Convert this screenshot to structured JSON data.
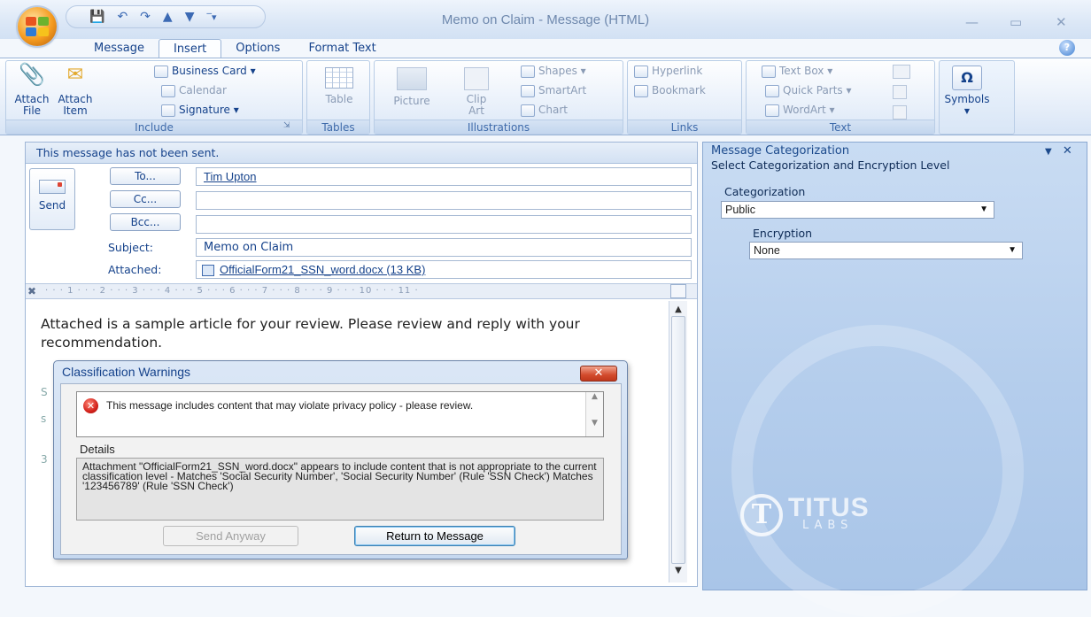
{
  "window": {
    "title": "Memo on Claim  - Message (HTML)"
  },
  "ribbon": {
    "tabs": [
      "Message",
      "Insert",
      "Options",
      "Format Text"
    ],
    "active_tab": "Insert",
    "groups": {
      "include": {
        "label": "Include",
        "attach_file": [
          "Attach",
          "File"
        ],
        "attach_item": [
          "Attach",
          "Item"
        ],
        "business_card": "Business Card ▾",
        "calendar": "Calendar",
        "signature": "Signature ▾"
      },
      "tables": {
        "label": "Tables",
        "table": "Table"
      },
      "illustrations": {
        "label": "Illustrations",
        "picture": "Picture",
        "clip_art": [
          "Clip",
          "Art"
        ],
        "shapes": "Shapes ▾",
        "smartart": "SmartArt",
        "chart": "Chart"
      },
      "links": {
        "label": "Links",
        "hyperlink": "Hyperlink",
        "bookmark": "Bookmark"
      },
      "text": {
        "label": "Text",
        "text_box": "Text Box ▾",
        "quick_parts": "Quick Parts ▾",
        "wordart": "WordArt ▾"
      },
      "symbols": {
        "label": "Symbols"
      }
    }
  },
  "message": {
    "info_bar": "This message has not been sent.",
    "send_label": "Send",
    "to_button": "To...",
    "cc_button": "Cc...",
    "bcc_button": "Bcc...",
    "to_value": "Tim Upton",
    "cc_value": "",
    "bcc_value": "",
    "subject_label": "Subject:",
    "subject_value": "Memo on Claim",
    "attached_label": "Attached:",
    "attachment": "OfficialForm21_SSN_word.docx (13 KB)",
    "ruler": "· · · 1 · · · 2 · · · 3 · · · 4 · · · 5 · · · 6 · · · 7 · · · 8 · · · 9 · · · 10 · · · 11 ·",
    "body": "Attached is a sample article for your review. Please review and reply with your recommendation."
  },
  "dialog": {
    "title": "Classification Warnings",
    "warning": "This message includes content that may violate privacy policy - please review.",
    "details_label": "Details",
    "details": "Attachment \"OfficialForm21_SSN_word.docx\" appears to include content that is not appropriate to the current classification level - Matches 'Social Security Number', 'Social Security Number' (Rule 'SSN Check') Matches '123456789' (Rule 'SSN Check')",
    "send_anyway": "Send Anyway",
    "return_to_message": "Return to Message"
  },
  "pane": {
    "title": "Message Categorization",
    "subtitle": "Select Categorization and Encryption Level",
    "categorization_label": "Categorization",
    "categorization_value": "Public",
    "encryption_label": "Encryption",
    "encryption_value": "None",
    "watermark_brand": "TITUS",
    "watermark_sub": "LABS"
  },
  "colors": {
    "accent": "#15428b",
    "ribbon": "#dbe7f6",
    "pane": "#b4cdec",
    "error": "#d3211a"
  }
}
